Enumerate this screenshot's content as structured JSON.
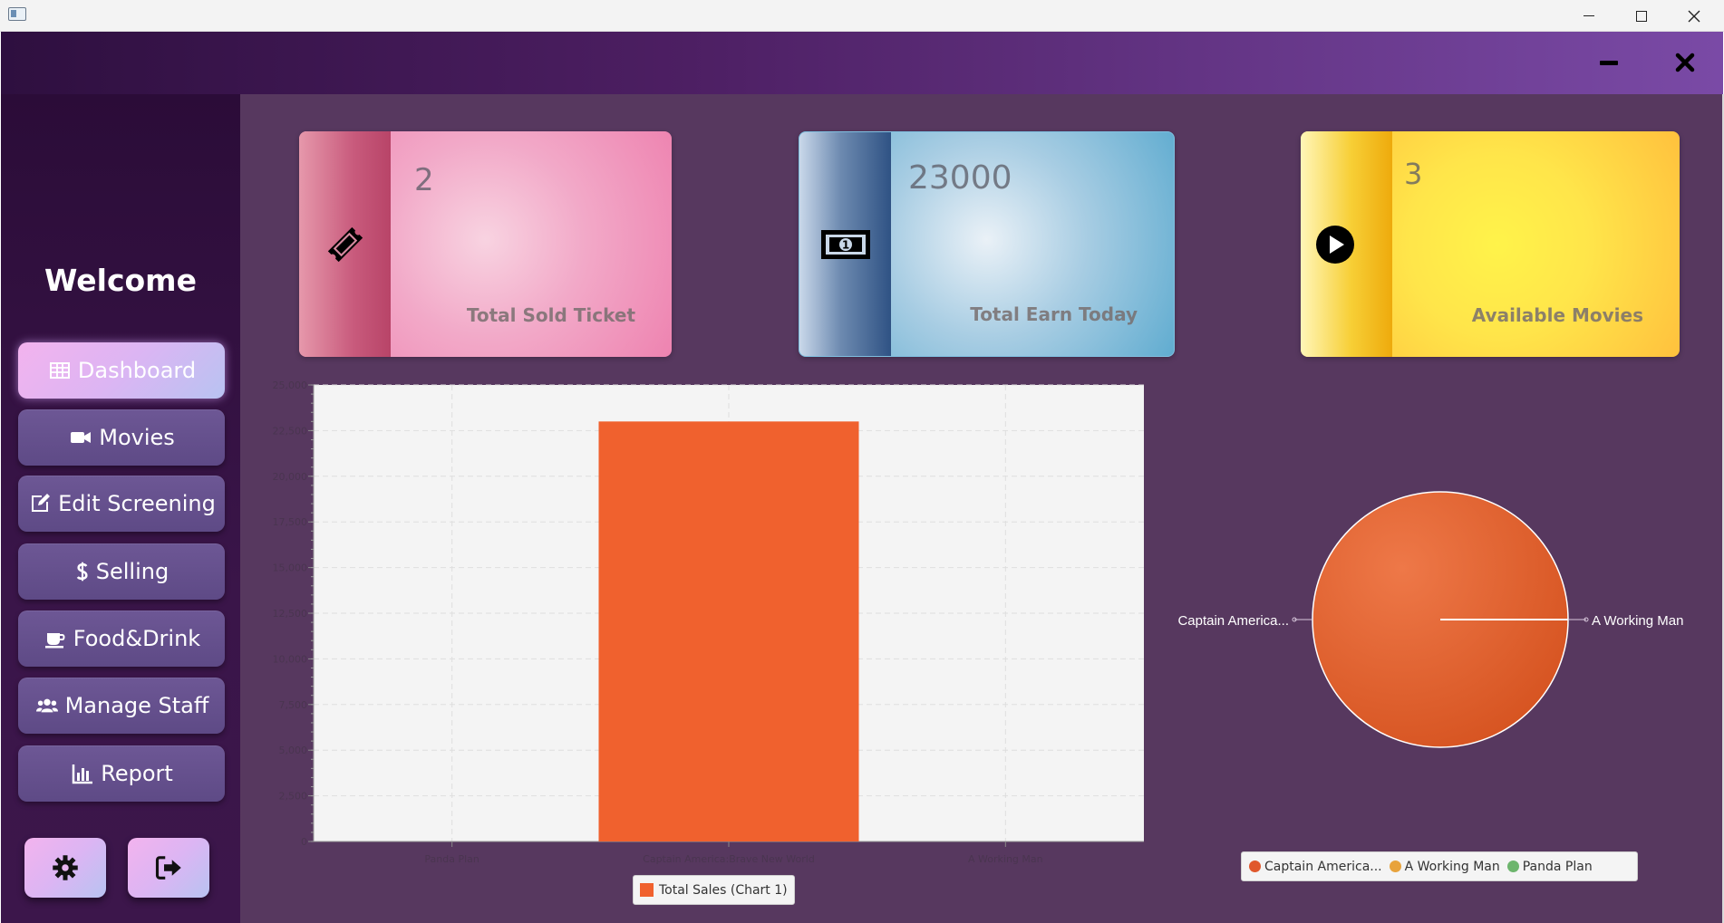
{
  "window": {
    "title": ""
  },
  "header": {
    "minimize_icon": "minimize-icon",
    "close_icon": "close-icon"
  },
  "sidebar": {
    "welcome": "Welcome",
    "items": [
      {
        "label": "Dashboard",
        "icon": "table-icon",
        "active": true
      },
      {
        "label": "Movies",
        "icon": "video-camera-icon"
      },
      {
        "label": "Edit Screening",
        "icon": "edit-icon"
      },
      {
        "label": "Selling",
        "icon": "dollar-icon"
      },
      {
        "label": "Food&Drink",
        "icon": "coffee-icon"
      },
      {
        "label": "Manage Staff",
        "icon": "users-icon"
      },
      {
        "label": "Report",
        "icon": "bar-chart-icon"
      }
    ],
    "bottom": {
      "settings_icon": "gear-icon",
      "logout_icon": "sign-out-icon"
    }
  },
  "cards": {
    "tickets": {
      "value": "2",
      "label": "Total Sold Ticket",
      "icon": "ticket-icon"
    },
    "earn": {
      "value": "23000",
      "label": "Total Earn Today",
      "icon": "money-icon"
    },
    "movies": {
      "value": "3",
      "label": "Available Movies",
      "icon": "play-icon"
    }
  },
  "chart_data": [
    {
      "type": "bar",
      "categories": [
        "Panda Plan",
        "Captain America:Brave New World",
        "A Working Man"
      ],
      "series": [
        {
          "name": "Total Sales (Chart 1)",
          "values": [
            0,
            23000,
            0
          ],
          "color": "#f0612e"
        }
      ],
      "ylim": [
        0,
        25000
      ],
      "yticks": [
        "0",
        "2,500",
        "5,000",
        "7,500",
        "10,000",
        "12,500",
        "15,000",
        "17,500",
        "20,000",
        "22,500",
        "25,000"
      ],
      "grid": true,
      "legend_position": "bottom"
    },
    {
      "type": "pie",
      "slices": [
        {
          "label": "Captain America...",
          "value": 23000,
          "color": "#e0582c"
        },
        {
          "label": "A Working Man",
          "value": 0,
          "color": "#e8a33c"
        },
        {
          "label": "Panda Plan",
          "value": 0,
          "color": "#6db56d"
        }
      ],
      "slice_labels": [
        "Captain America...",
        "A Working Man"
      ],
      "legend": [
        "Captain America...",
        "A Working Man",
        "Panda Plan"
      ],
      "legend_position": "bottom"
    }
  ]
}
